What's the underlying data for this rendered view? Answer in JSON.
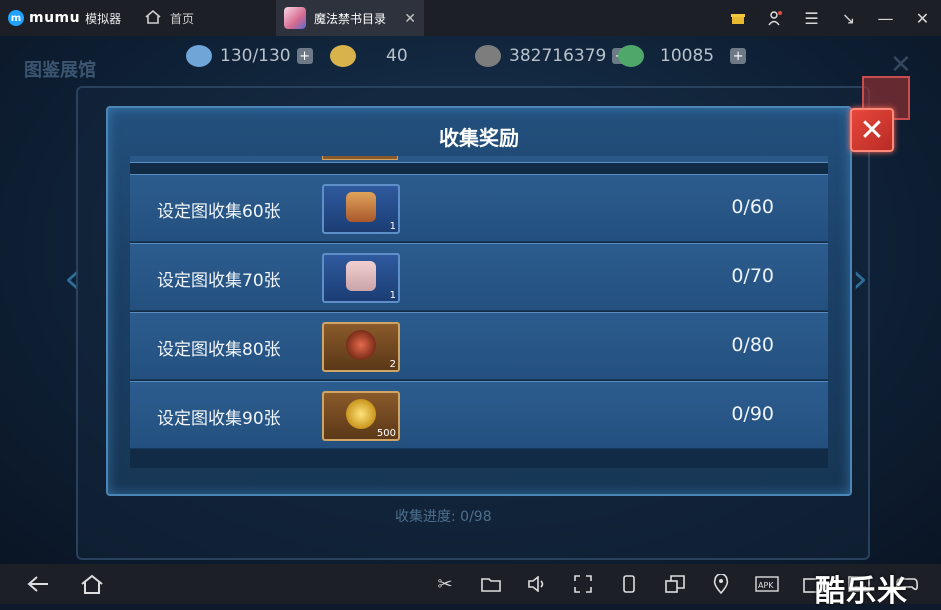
{
  "titlebar": {
    "brand": "mumu",
    "brand_sub": "模拟器",
    "tabs": [
      {
        "label": "首页",
        "active": false
      },
      {
        "label": "魔法禁书目录",
        "active": true,
        "close": "✕"
      }
    ],
    "icons": [
      "gift-icon",
      "user-icon",
      "menu-icon",
      "restore-icon",
      "minimize-icon",
      "close-icon"
    ]
  },
  "hud": {
    "resources": [
      {
        "name": "brain-icon",
        "value": "130/130",
        "color": "#6ea6d8"
      },
      {
        "name": "bag-icon",
        "value": "40",
        "color": "#d8b24a"
      },
      {
        "name": "coin-icon",
        "value": "382716379",
        "color": "#7d7d7d"
      },
      {
        "name": "gem-icon",
        "value": "10085",
        "color": "#4fa86a"
      }
    ],
    "plus": "+"
  },
  "background": {
    "title": "图鉴展馆",
    "progress_text": "收集进度: 0/98"
  },
  "modal": {
    "title": "收集奖励",
    "close": "✕",
    "rows": [
      {
        "label": "设定图收集60张",
        "item_icon": "treasure-chest-icon",
        "qty": "1",
        "progress": "0/60",
        "style": "blue"
      },
      {
        "label": "设定图收集70张",
        "item_icon": "silver-chest-icon",
        "qty": "1",
        "progress": "0/70",
        "style": "blue"
      },
      {
        "label": "设定图收集80张",
        "item_icon": "food-platter-icon",
        "qty": "2",
        "progress": "0/80",
        "style": "gold"
      },
      {
        "label": "设定图收集90张",
        "item_icon": "gold-coin-icon",
        "qty": "500",
        "progress": "0/90",
        "style": "gold"
      }
    ]
  },
  "toolbar": {
    "left": [
      "back-icon",
      "home-icon"
    ],
    "right": [
      "scissors-icon",
      "folder-icon",
      "volume-icon",
      "fullscreen-icon",
      "rotate-icon",
      "multiwindow-icon",
      "location-icon",
      "apk-icon",
      "screenshot-icon",
      "keyboard-icon",
      "gamepad-icon"
    ]
  },
  "watermark": "酷乐米"
}
